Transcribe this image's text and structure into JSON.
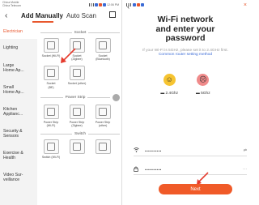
{
  "left": {
    "status": {
      "carrier": "China Mobile\nChina Telecom",
      "time": "12:06 PM"
    },
    "tabs": [
      "Add Manually",
      "Auto Scan"
    ],
    "categories": [
      "Electrician",
      "Lighting",
      "Large\nHome Ap...",
      "Small\nHome Ap...",
      "Kitchen\nApplianc...",
      "Security &\nSensors",
      "Exercise &\nHealth",
      "Video Sur-\nveillance"
    ],
    "sections": {
      "socket": {
        "title": "Socket",
        "items": [
          "Socket (Wi-Fi)",
          "Socket\n(Zigbee)",
          "Socket\n(Bluetooth)",
          "Socket\n(BE)",
          "Socket (other)"
        ]
      },
      "power_strip": {
        "title": "Power Strip",
        "items": [
          "Power Strip\n(Wi-Fi)",
          "Power Strip\n(Zigbee)",
          "Power Strip\n(other)"
        ]
      },
      "switch": {
        "title": "Switch",
        "items": [
          "Switch (Wi-Fi)",
          "",
          ""
        ]
      }
    }
  },
  "right": {
    "title": "Wi-Fi network\nand enter your\npassword",
    "desc_prefix": "If your Wi-Fi is 5GHz, please set it to 2.4GHz first. ",
    "desc_link": "Common router setting method",
    "faces": [
      {
        "label": "2.4Ghz",
        "type": "good",
        "glyph": "☺"
      },
      {
        "label": "5Ghz",
        "type": "bad",
        "glyph": "☹"
      }
    ],
    "wifi_value": "••••••••••",
    "password_value": "••••••••••",
    "next_label": "Next",
    "close_glyph": "×"
  },
  "colors": {
    "accent": "#e8572d",
    "link": "#3b6bd6"
  },
  "icons": [
    "back-arrow-icon",
    "scan-icon",
    "wifi-icon",
    "lock-icon",
    "socket-icon",
    "emoji-happy-icon",
    "emoji-sad-icon",
    "red-arrow-annotation-icon"
  ]
}
